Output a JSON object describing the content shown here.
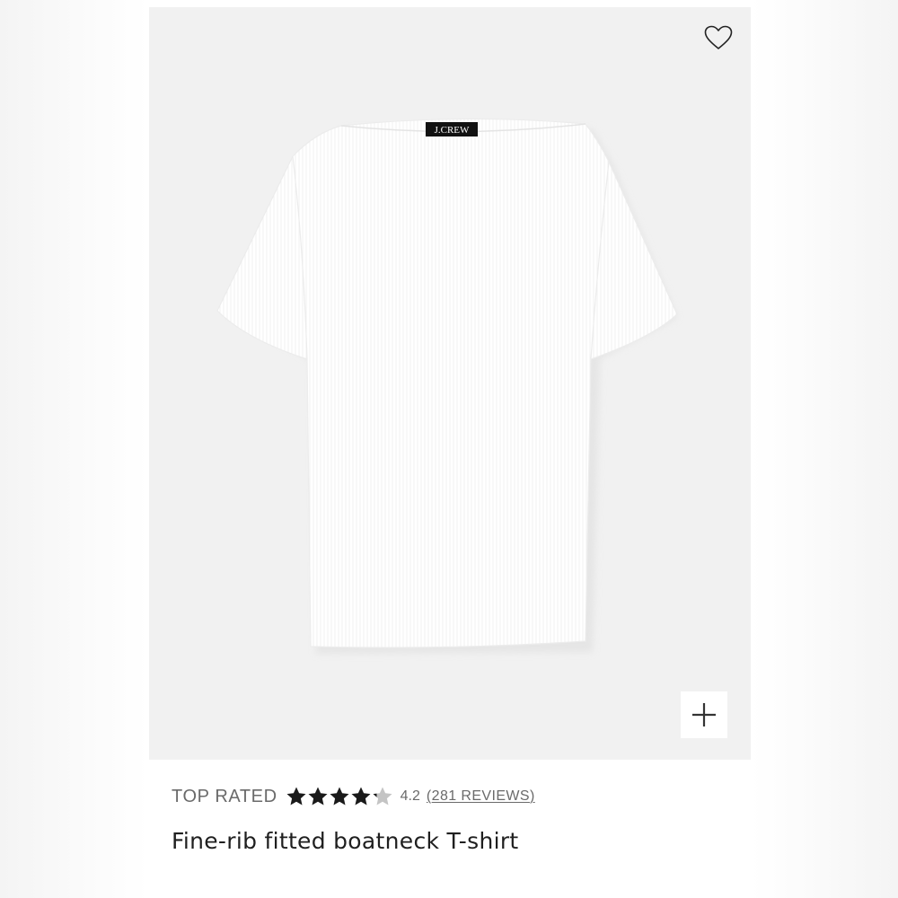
{
  "product": {
    "name": "Fine-rib fitted boatneck T-shirt",
    "badge": "TOP RATED",
    "rating": 4.2,
    "rating_text": "4.2",
    "rating_max": 5,
    "reviews_open": "(",
    "reviews_label": "281 REVIEWS",
    "reviews_close": ")",
    "brand_label": "J.CREW"
  },
  "icons": {
    "wishlist": "heart-outline-icon",
    "expand": "plus-icon",
    "star": "star-icon"
  },
  "colors": {
    "image_background": "#f1f1f1",
    "star_filled": "#1a1a1a",
    "star_empty": "#c4c4c4",
    "meta_text": "#6a6a6a",
    "title_text": "#1f1f1f"
  }
}
